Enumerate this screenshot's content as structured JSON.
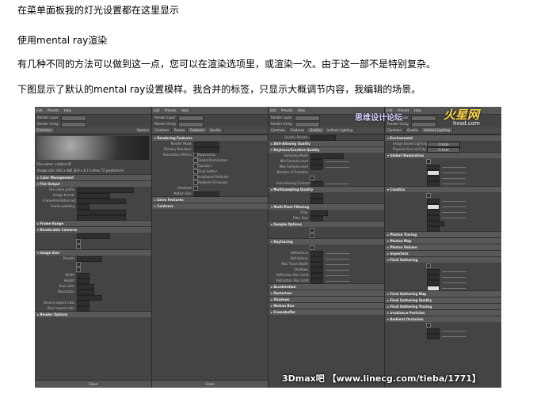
{
  "text": {
    "p1": "在菜单面板我的灯光设置都在这里显示",
    "p2": "使用mental ray渲染",
    "p3": "有几种不同的方法可以做到这一点，您可以在渲染选项里，或渲染一次。由于这一部不是特别复杂。",
    "p4": "下图显示了默认的mental ray设置模样。我合并的标签，只显示大概调节内容，我编辑的场景。"
  },
  "screenshot": {
    "watermark_1": "思维设计论坛",
    "watermark_2": "火星网",
    "watermark_3": "hxsd.com",
    "footer_watermark": "3Dmax吧 【www.linecg.com/tieba/1771】",
    "close_label": "Close",
    "menu": [
      "Edit",
      "Presets",
      "Help"
    ],
    "render_layer_label": "Render Layer",
    "render_using_label": "Render Using",
    "render_layer_value": "masterLayer",
    "render_using_value": "mental ray",
    "panel1": {
      "tabs": [
        "Common",
        "Passes",
        "Features",
        "Quality",
        "Indirect Lighting",
        "Options"
      ],
      "path_text": "File name: untitled.iff",
      "image_size_text": "Image size: 640 x 480 (8.9 x 6.7 inches 72 pixels/inch)",
      "sections": [
        "Color Management",
        "File Output",
        "Frame Range",
        "Renderable Cameras",
        "Image Size",
        "Render Options"
      ],
      "file_output_fields": [
        "File name prefix",
        "Image format",
        "Frame/Animation ext",
        "Frame padding"
      ],
      "image_size_fields": [
        "Presets",
        "Width",
        "Height",
        "Size units",
        "Resolution",
        "Device aspect ratio",
        "Pixel aspect ratio"
      ]
    },
    "panel2": {
      "tabs": [
        "Common",
        "Passes",
        "Features",
        "Quality",
        "Indirect Lighting",
        "Options"
      ],
      "sections": [
        "Rendering Features",
        "Extra Features",
        "Contours"
      ],
      "feature_fields": [
        "Render Mode",
        "Primary Renderer",
        "Secondary Effects"
      ],
      "checks": [
        "Raytracing",
        "Global Illumination",
        "Caustics",
        "Final Gather",
        "Irradiance Particles",
        "Ambient Occlusion"
      ],
      "other_fields": [
        "Shadows",
        "Motion Blur"
      ]
    },
    "panel3": {
      "tabs": [
        "Common",
        "Passes",
        "Features",
        "Quality",
        "Indirect Lighting",
        "Options"
      ],
      "quality_presets": "Quality Presets",
      "sections": [
        "Anti-Aliasing Quality",
        "Raytrace/Scanline Quality",
        "Multisampling Quality",
        "Multi-Pixel Filtering",
        "Sample Options",
        "Raytracing",
        "Acceleration",
        "Rasterizer",
        "Shadows",
        "Motion Blur",
        "Framebuffer"
      ],
      "fields": [
        "Sampling Mode",
        "Min Sample Level",
        "Max Sample Level",
        "Number of Samples",
        "Anti-aliasing Contrast",
        "Filter",
        "Filter Size",
        "Reflections",
        "Refractions",
        "Max Trace Depth",
        "Shadows",
        "Reflection Blur Limit",
        "Refraction Blur Limit"
      ]
    },
    "panel4": {
      "tabs": [
        "Common",
        "Passes",
        "Features",
        "Quality",
        "Indirect Lighting",
        "Options"
      ],
      "sections": [
        "Environment",
        "Global Illumination",
        "Caustics",
        "Photon Tracing",
        "Photon Map",
        "Photon Volume",
        "Importons",
        "Final Gathering",
        "Final Gathering Map",
        "Final Gathering Quality",
        "Final Gathering Tracing",
        "Irradiance Particles",
        "Ambient Occlusion"
      ],
      "env_fields": [
        "Image Based Lighting",
        "Physical Sun and Sky"
      ],
      "create_label": "Create"
    }
  }
}
